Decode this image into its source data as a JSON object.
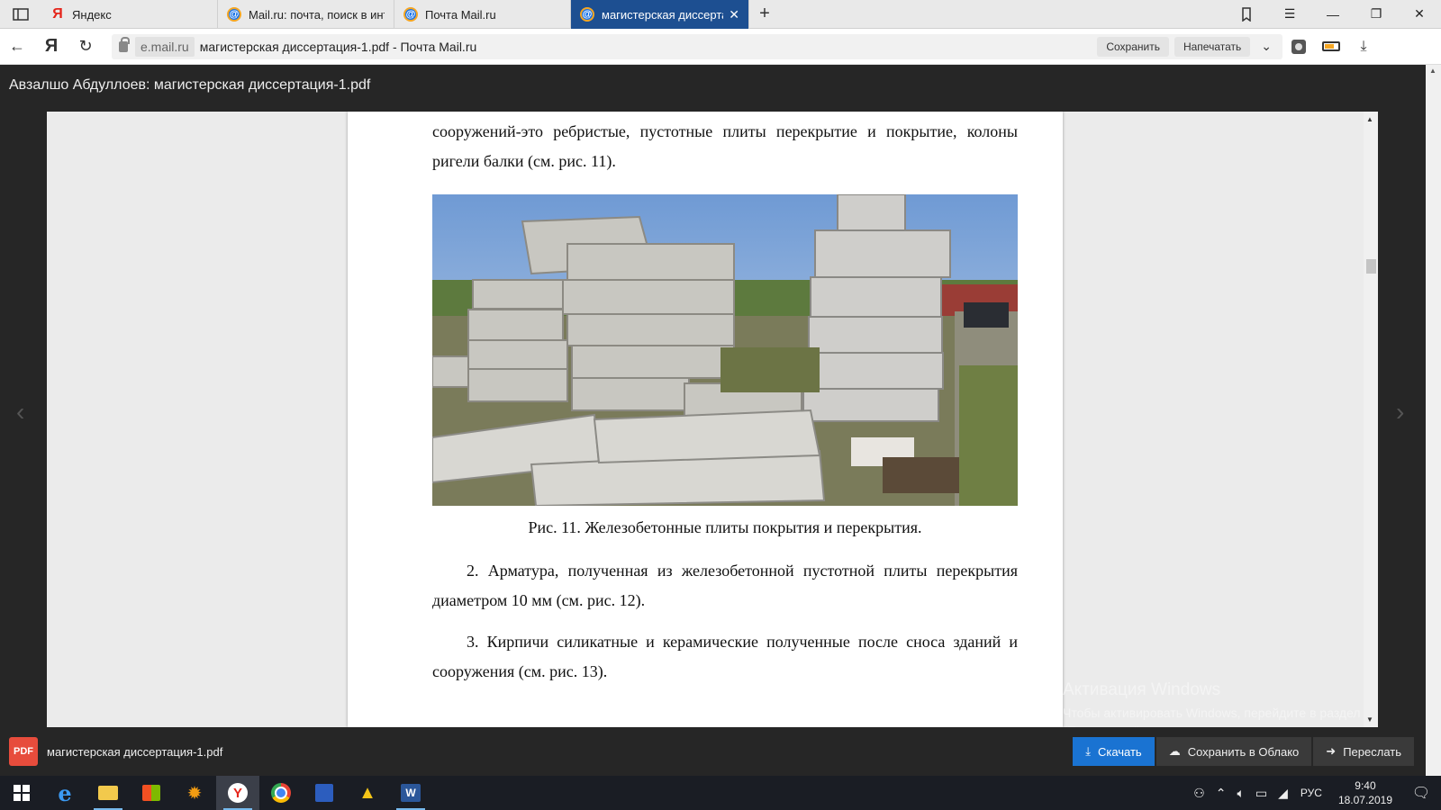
{
  "browser": {
    "tabs": [
      {
        "title": "Яндекс",
        "icon": "yandex-icon",
        "active": false
      },
      {
        "title": "Mail.ru: почта, поиск в инте",
        "icon": "mail-ru-icon",
        "active": false
      },
      {
        "title": "Почта Mail.ru",
        "icon": "mail-ru-icon",
        "active": false
      },
      {
        "title": "магистерская диссертац",
        "icon": "mail-ru-icon",
        "active": true
      }
    ],
    "domain": "e.mail.ru",
    "page_title": "магистерская диссертация-1.pdf - Почта Mail.ru",
    "save_label": "Сохранить",
    "print_label": "Напечатать"
  },
  "viewer": {
    "title": "Авзалшо Абдуллоев: магистерская диссертация-1.pdf",
    "file_badge": "PDF",
    "file_name": "магистерская диссертация-1.pdf",
    "download_label": "Скачать",
    "cloud_label": "Сохранить в Облако",
    "forward_label": "Переслать"
  },
  "document": {
    "para1": "сооружений-это ребристые, пустотные плиты перекрытие и покрытие, колоны ригели балки (см. рис. 11).",
    "caption": "Рис. 11. Железобетонные плиты покрытия и перекрытия.",
    "para2": "2. Арматура, полученная из железобетонной пустотной плиты перекрытия диаметром 10 мм (см. рис. 12).",
    "para3": "3. Кирпичи силикатные и керамические полученные после сноса зданий и сооружения (см. рис. 13)."
  },
  "watermark": {
    "title": "Активация Windows",
    "subtitle": "Чтобы активировать Windows, перейдите в раздел \"Параметры\"."
  },
  "taskbar": {
    "language": "РУС",
    "time": "9:40",
    "date": "18.07.2019"
  }
}
